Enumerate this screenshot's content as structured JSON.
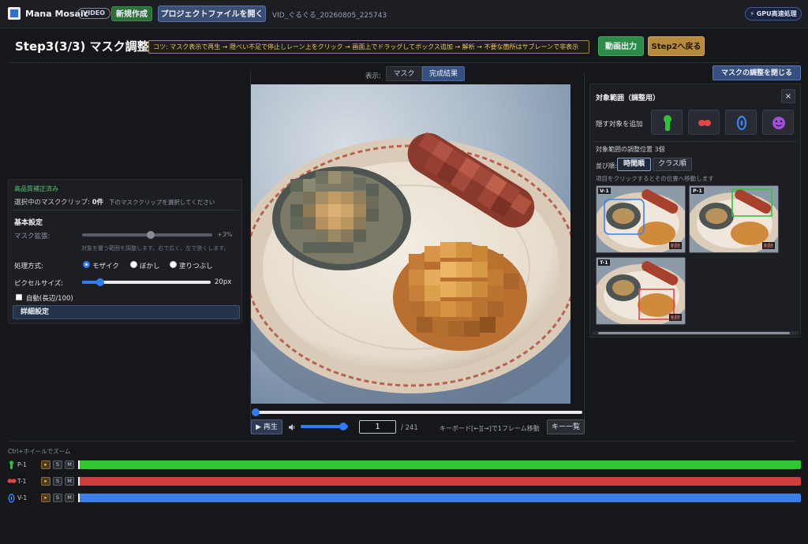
{
  "topbar": {
    "app_name": "Mana Mosaic",
    "badge": "VIDEO",
    "new_button": "新規作成",
    "open_button": "プロジェクトファイルを開く",
    "filename": "VID_ぐるぐる_20260805_225743",
    "gpu": "⚡ GPU高速処理"
  },
  "header": {
    "title": "Step3(3/3) マスク調整",
    "tip": "コツ: マスク表示で再生 → 隠べい不足で停止しレーン上をクリック → 画面上でドラッグしてボックス追加 → 解析 → 不要な箇所はサブレーンで非表示",
    "export_button": "動画出力",
    "back_button": "Step2へ戻る"
  },
  "left": {
    "quality": "高品質補正済み",
    "clip_prefix": "選択中のマスククリップ:",
    "clip_count": "0件",
    "clip_hint": "下のマスククリップを選択してください",
    "basic": "基本設定",
    "mask_expand_label": "マスク拡張:",
    "mask_expand_value": "+3%",
    "mask_expand_fraction": 0.53,
    "mask_expand_hint": "対象を覆う範囲を調整します。右で広く、左で狭くします。",
    "method_label": "処理方式:",
    "methods": [
      "モザイク",
      "ぼかし",
      "塗りつぶし"
    ],
    "method_selected": 0,
    "pixel_label": "ピクセルサイズ:",
    "pixel_value": "20px",
    "pixel_fraction": 0.14,
    "auto_label": "自動(長辺/100)",
    "auto_checked": false,
    "detail_button": "詳細設定"
  },
  "center": {
    "display_label": "表示:",
    "tab_mask": "マスク",
    "tab_result": "完成結果",
    "active_tab": "完成結果",
    "play_button": "▶ 再生",
    "frame": "1",
    "frame_total": "/ 241",
    "kbd_hint": "キーボード[←][→]で1フレーム移動",
    "key_button": "キー一覧",
    "volume_fraction": 0.9,
    "progress_fraction": 0.0
  },
  "right": {
    "close_adjust": "マスクの調整を閉じる",
    "title": "対象範囲（調整用）",
    "close": "×",
    "hide_label": "隠す対象を追加",
    "add_icons": [
      "nipple-icon",
      "lips-icon",
      "vulva-icon",
      "face-icon"
    ],
    "positions_label": "対象範囲の調整位置 3個",
    "sort_label": "並び順:",
    "sort_time": "時間順",
    "sort_class": "クラス順",
    "click_hint": "項目をクリックするとその位置へ移動します",
    "thumbs": [
      {
        "label": "V-1",
        "del": "削除",
        "color": "#3b82f6"
      },
      {
        "label": "P-1",
        "del": "削除",
        "color": "#2fc33b"
      },
      {
        "label": "T-1",
        "del": "削除",
        "color": "#e04848"
      }
    ]
  },
  "timeline": {
    "zoom_hint": "Ctrl+ホイールでズーム",
    "tracks": [
      {
        "label": "P-1",
        "color": "#2fc72f",
        "icon": "nipple-icon"
      },
      {
        "label": "T-1",
        "color": "#d33c3c",
        "icon": "lips-icon"
      },
      {
        "label": "V-1",
        "color": "#3b7fe6",
        "icon": "vulva-icon"
      }
    ],
    "btn_play": "▸",
    "btn_s": "S",
    "btn_m": "M"
  }
}
